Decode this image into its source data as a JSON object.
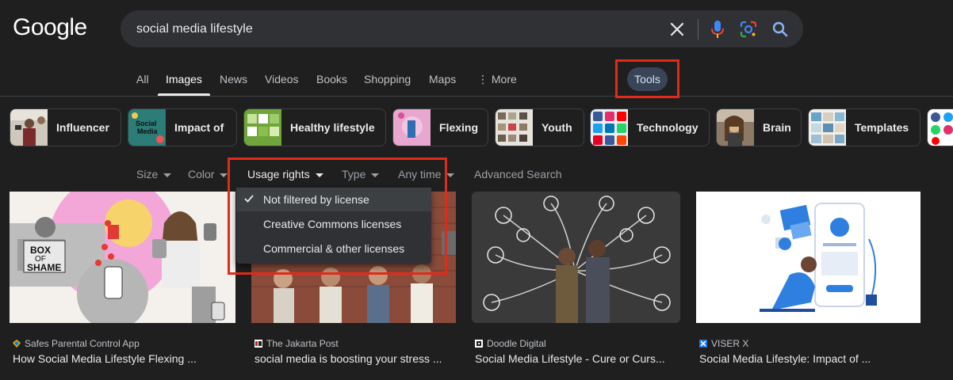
{
  "logo": "Google",
  "search": {
    "value": "social media lifestyle"
  },
  "tabs": [
    {
      "label": "All"
    },
    {
      "label": "Images"
    },
    {
      "label": "News"
    },
    {
      "label": "Videos"
    },
    {
      "label": "Books"
    },
    {
      "label": "Shopping"
    },
    {
      "label": "Maps"
    },
    {
      "label": "⋮ More"
    }
  ],
  "tools_label": "Tools",
  "chips": [
    {
      "label": "Influencer"
    },
    {
      "label": "Impact of"
    },
    {
      "label": "Healthy lifestyle"
    },
    {
      "label": "Flexing"
    },
    {
      "label": "Youth"
    },
    {
      "label": "Technology"
    },
    {
      "label": "Brain"
    },
    {
      "label": "Templates"
    }
  ],
  "filters": {
    "size": "Size",
    "color": "Color",
    "usage_rights": "Usage rights",
    "type": "Type",
    "time": "Any time",
    "advanced": "Advanced Search"
  },
  "usage_dropdown": [
    {
      "label": "Not filtered by license",
      "selected": true
    },
    {
      "label": "Creative Commons licenses",
      "selected": false
    },
    {
      "label": "Commercial & other licenses",
      "selected": false
    }
  ],
  "results": [
    {
      "source": "Safes Parental Control App",
      "title": "How Social Media Lifestyle Flexing ..."
    },
    {
      "source": "The Jakarta Post",
      "title": "social media is boosting your stress ..."
    },
    {
      "source": "Doodle Digital",
      "title": "Social Media Lifestyle - Cure or Curs..."
    },
    {
      "source": "VISER X",
      "title": "Social Media Lifestyle: Impact of ..."
    }
  ],
  "image_text": {
    "box_line1": "BOX",
    "box_line2": "OF",
    "box_line3": "SHAME",
    "impact_thumb_line1": "Social",
    "impact_thumb_line2": "Media"
  },
  "colors": {
    "background": "#1f1f1f",
    "searchbox": "#303134",
    "tools_bg": "#394457",
    "highlight": "#e02a1a",
    "link_blue": "#8ab4f8"
  }
}
